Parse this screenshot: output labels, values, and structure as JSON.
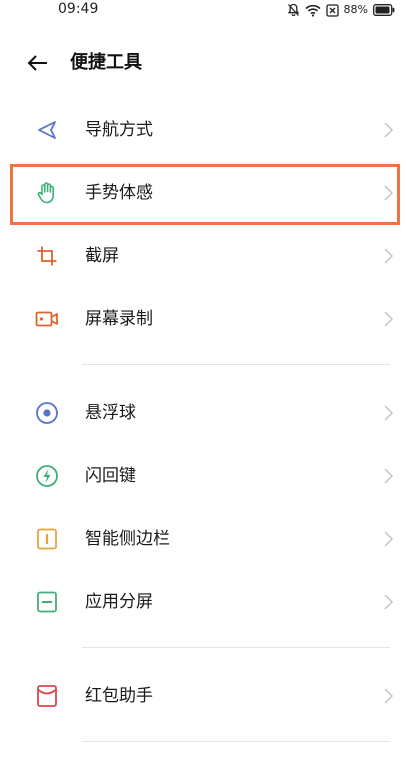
{
  "status_bar": {
    "time": "09:49",
    "battery_percent": "88%",
    "icons": [
      "mute-bell-icon",
      "wifi-icon",
      "sim-x-icon",
      "battery-icon"
    ]
  },
  "header": {
    "back_icon": "arrow-left-icon",
    "title": "便捷工具"
  },
  "items": [
    {
      "label": "导航方式",
      "icon": "navigation-triangle-icon",
      "icon_color": "#5b74c7"
    },
    {
      "label": "手势体感",
      "icon": "hand-gesture-icon",
      "icon_color": "#3fae7a",
      "highlighted": true
    },
    {
      "label": "截屏",
      "icon": "crop-screenshot-icon",
      "icon_color": "#e0622e"
    },
    {
      "label": "屏幕录制",
      "icon": "video-record-icon",
      "icon_color": "#e0622e"
    },
    {
      "label": "悬浮球",
      "icon": "floating-ball-icon",
      "icon_color": "#5b74c7"
    },
    {
      "label": "闪回键",
      "icon": "flash-back-icon",
      "icon_color": "#3fae7a"
    },
    {
      "label": "智能侧边栏",
      "icon": "smart-sidebar-icon",
      "icon_color": "#e8a33a"
    },
    {
      "label": "应用分屏",
      "icon": "split-screen-icon",
      "icon_color": "#3fae7a"
    },
    {
      "label": "红包助手",
      "icon": "red-envelope-icon",
      "icon_color": "#d9484b"
    }
  ],
  "colors": {
    "highlight_border": "#ef7443",
    "chevron": "#c4c4c4",
    "divider": "#e6e6e6"
  }
}
